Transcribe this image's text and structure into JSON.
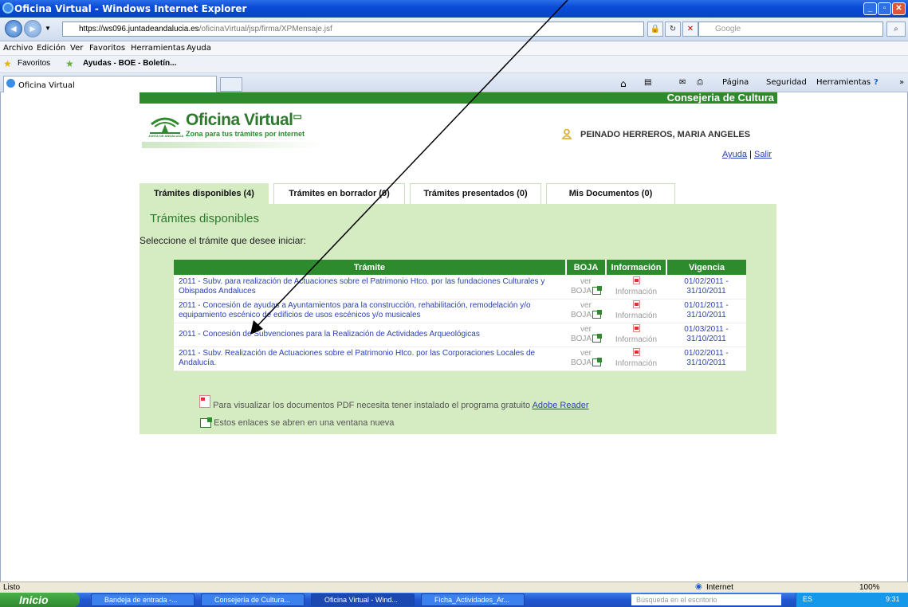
{
  "window": {
    "title": "Oficina Virtual - Windows Internet Explorer",
    "address_host": "https://ws096.juntadeandalucia.es",
    "address_path": "/oficinaVirtual/jsp/firma/XPMensaje.jsf",
    "search_placeholder": "Google",
    "menu": [
      "Archivo",
      "Edición",
      "Ver",
      "Favoritos",
      "Herramientas",
      "Ayuda"
    ],
    "favorites_label": "Favoritos",
    "fav_link": "Ayudas - BOE - Boletín...",
    "tab_title": "Oficina Virtual",
    "cmd": {
      "pagina": "Página",
      "seguridad": "Seguridad",
      "herramientas": "Herramientas"
    }
  },
  "site": {
    "dept": "Consejeria de Cultura",
    "logo_text": "JUNTA DE ANDALUCIA",
    "title": "Oficina Virtual",
    "subtitle": "Zona para tus trámites por internet",
    "user": "PEINADO HERREROS, MARIA ANGELES",
    "help": "Ayuda",
    "sep": "|",
    "logout": "Salir"
  },
  "tabs": [
    {
      "label": "Trámites disponibles (4)"
    },
    {
      "label": "Trámites en borrador (0)"
    },
    {
      "label": "Trámites presentados (0)"
    },
    {
      "label": "Mis Documentos (0)"
    }
  ],
  "panel": {
    "title": "Trámites disponibles",
    "subtitle": "Seleccione el trámite que desee iniciar:"
  },
  "table": {
    "headers": [
      "Trámite",
      "BOJA",
      "Información",
      "Vigencia"
    ],
    "boja_label_1": "ver",
    "boja_label_2": "BOJA",
    "info_label": "Información",
    "rows": [
      {
        "tramite": "2011 - Subv. para realización de Actuaciones sobre el Patrimonio Htco. por las fundaciones Culturales y Obispados Andaluces",
        "vig_from": "01/02/2011 -",
        "vig_to": "31/10/2011"
      },
      {
        "tramite": "2011 - Concesión de ayudas a Ayuntamientos para la construcción, rehabilitación, remodelación y/o equipamiento escénico de edificios de usos escénicos y/o musicales",
        "vig_from": "01/01/2011 -",
        "vig_to": "31/10/2011"
      },
      {
        "tramite": "2011 - Concesión de Subvenciones para la Realización de Actividades Arqueológicas",
        "vig_from": "01/03/2011 -",
        "vig_to": "31/10/2011"
      },
      {
        "tramite": "2011 - Subv. Realización de Actuaciones sobre el Patrimonio Htco. por las Corporaciones Locales de Andalucía.",
        "vig_from": "01/02/2011 -",
        "vig_to": "31/10/2011"
      }
    ]
  },
  "notes": {
    "pdf": "Para visualizar los documentos PDF necesita tener instalado el programa gratuito",
    "pdf_link": "Adobe Reader",
    "ext": "Estos enlaces se abren en una ventana nueva"
  },
  "status": {
    "left": "Listo",
    "zone": "Internet",
    "zoom": "100%"
  },
  "taskbar": {
    "start": "Inicio",
    "items": [
      "Bandeja de entrada -...",
      "Consejería de Cultura...",
      "Oficina Virtual - Wind...",
      "Ficha_Actividades_Ar..."
    ],
    "search": "Búsqueda en el escritorio",
    "lang": "ES",
    "clock": "9:31"
  }
}
